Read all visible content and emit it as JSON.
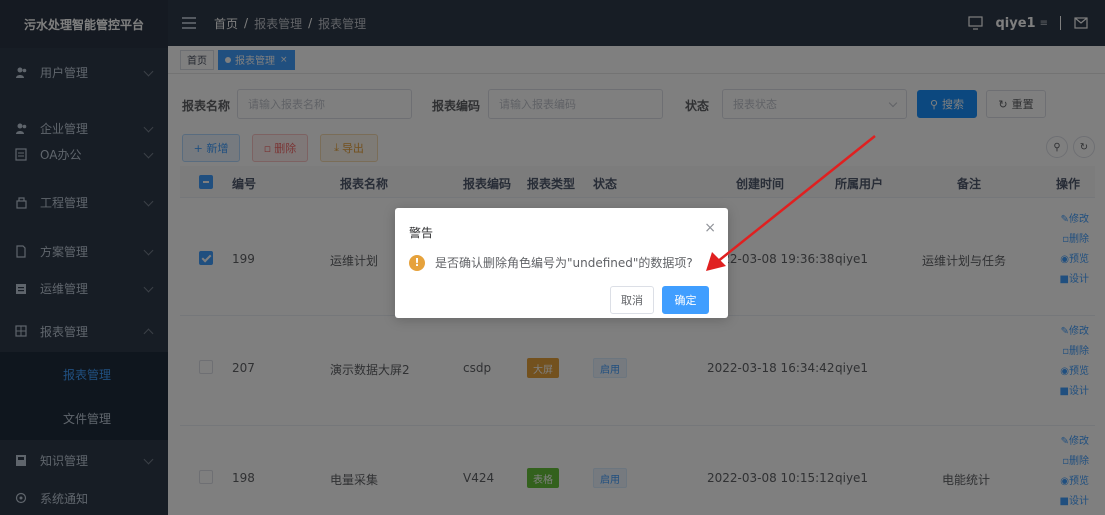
{
  "app": {
    "title": "污水处理智能管控平台"
  },
  "sidebar": {
    "items": [
      {
        "label": "用户管理",
        "icon": "users-icon"
      },
      {
        "label": "企业管理",
        "icon": "users-icon"
      },
      {
        "label": "OA办公",
        "icon": "document-icon"
      },
      {
        "label": "工程管理",
        "icon": "tools-icon"
      },
      {
        "label": "方案管理",
        "icon": "doc-icon"
      },
      {
        "label": "运维管理",
        "icon": "clipboard-icon"
      },
      {
        "label": "报表管理",
        "icon": "grid-icon",
        "expanded": true
      },
      {
        "label": "知识管理",
        "icon": "book-icon"
      },
      {
        "label": "系统通知",
        "icon": "bell-icon"
      }
    ],
    "report_submenu": [
      {
        "label": "报表管理",
        "active": true
      },
      {
        "label": "文件管理",
        "active": false
      }
    ]
  },
  "header": {
    "breadcrumb": [
      "首页",
      "报表管理",
      "报表管理"
    ],
    "breadcrumb_sep": "/",
    "username": "qiye1",
    "icons": [
      "screen-icon",
      "user-caret-icon",
      "mail-icon"
    ]
  },
  "tags": {
    "items": [
      {
        "label": "首页",
        "active": false
      },
      {
        "label": "报表管理",
        "active": true,
        "close": "×"
      }
    ]
  },
  "search": {
    "name_label": "报表名称",
    "name_placeholder": "请输入报表名称",
    "code_label": "报表编码",
    "code_placeholder": "请输入报表编码",
    "status_label": "状态",
    "status_placeholder": "报表状态",
    "search_button": "搜索",
    "reset_button": "重置"
  },
  "toolbar": {
    "add": "+ 新增",
    "delete": "删除",
    "export": "导出"
  },
  "table": {
    "columns": [
      "编号",
      "报表名称",
      "报表编码",
      "报表类型",
      "状态",
      "创建时间",
      "所属用户",
      "备注",
      "操作"
    ],
    "rows": [
      {
        "id": "199",
        "name": "运维计划",
        "code": "",
        "type": "",
        "type_color": "",
        "status": "",
        "created": "2022-03-08 19:36:38",
        "user": "qiye1",
        "remark": "运维计划与任务",
        "checked": true
      },
      {
        "id": "207",
        "name": "演示数据大屏2",
        "code": "csdp",
        "type": "大屏",
        "type_color": "#e6a23c",
        "status": "启用",
        "created": "2022-03-18 16:34:42",
        "user": "qiye1",
        "remark": "",
        "checked": false
      },
      {
        "id": "198",
        "name": "电量采集",
        "code": "V424",
        "type": "表格",
        "type_color": "#67c23a",
        "status": "启用",
        "created": "2022-03-08 10:15:12",
        "user": "qiye1",
        "remark": "电能统计",
        "checked": false
      }
    ],
    "ops": [
      "修改",
      "删除",
      "预览",
      "设计"
    ]
  },
  "dialog": {
    "title": "警告",
    "message": "是否确认删除角色编号为\"undefined\"的数据项?",
    "cancel": "取消",
    "confirm": "确定",
    "close": "×"
  },
  "colors": {
    "primary": "#409eff",
    "sidebar": "#2f3a4a",
    "warning": "#e6a23c",
    "success": "#67c23a",
    "annotation": "#e02020"
  }
}
